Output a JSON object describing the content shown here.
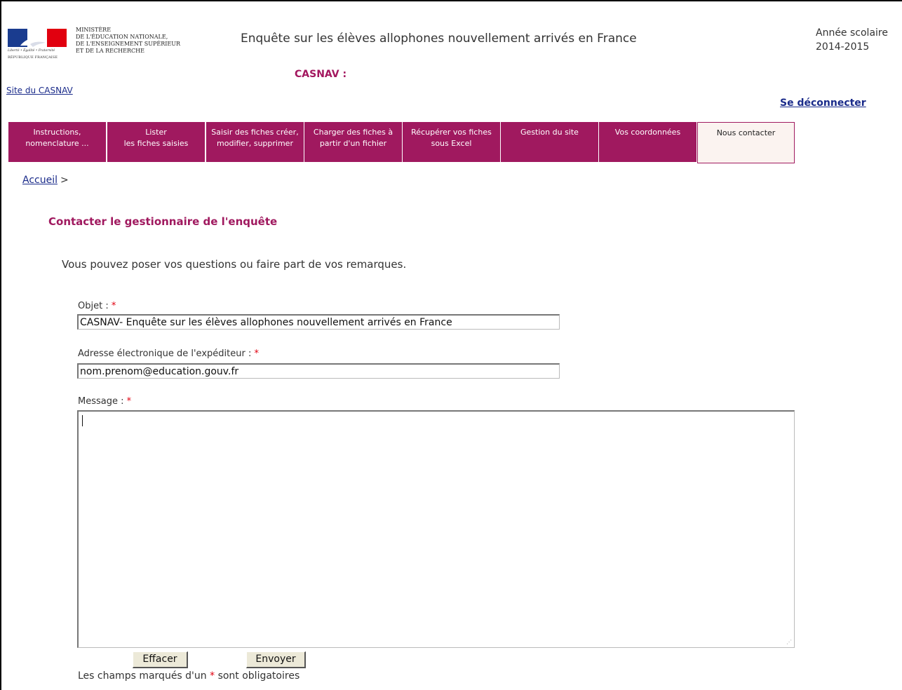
{
  "header": {
    "ministry_lines": [
      "MINISTÈRE",
      "DE L'ÉDUCATION NATIONALE,",
      "DE L'ENSEIGNEMENT SUPÉRIEUR",
      "ET DE LA RECHERCHE"
    ],
    "devise": "Liberté • Égalité • Fraternité",
    "republique": "RÉPUBLIQUE FRANÇAISE",
    "survey_title": "Enquête sur les élèves allophones nouvellement arrivés en France",
    "year_label": "Année scolaire",
    "year_value": "2014-2015",
    "casnav_label": "CASNAV :",
    "site_link": "Site du CASNAV",
    "logout": "Se déconnecter"
  },
  "nav": {
    "items": [
      {
        "line1": "Instructions,",
        "line2": "nomenclature ..."
      },
      {
        "line1": "Lister",
        "line2": "les fiches saisies"
      },
      {
        "line1": "Saisir des fiches créer,",
        "line2": "modifier, supprimer"
      },
      {
        "line1": "Charger des fiches à",
        "line2": "partir d'un fichier"
      },
      {
        "line1": "Récupérer vos fiches",
        "line2": "sous Excel"
      },
      {
        "line1": "Gestion du site",
        "line2": ""
      },
      {
        "line1": "Vos coordonnées",
        "line2": ""
      },
      {
        "line1": "Nous contacter",
        "line2": ""
      }
    ],
    "active_index": 7
  },
  "breadcrumb": {
    "home": "Accueil",
    "separator": ">"
  },
  "main": {
    "title": "Contacter le gestionnaire de l'enquête",
    "intro": "Vous pouvez poser vos questions ou faire part de vos remarques.",
    "required_mark": "*",
    "fields": {
      "objet_label": "Objet :",
      "objet_value": "CASNAV- Enquête sur les élèves allophones nouvellement arrivés en France",
      "email_label": "Adresse électronique de l'expéditeur :",
      "email_value": "nom.prenom@education.gouv.fr",
      "message_label": "Message :",
      "message_value": ""
    },
    "buttons": {
      "clear": "Effacer",
      "send": "Envoyer"
    },
    "required_note_before": "Les champs marqués d'un",
    "required_note_after": "sont obligatoires"
  },
  "colors": {
    "brand": "#a0195f",
    "link": "#1a2b8a",
    "required": "#e1000f"
  }
}
